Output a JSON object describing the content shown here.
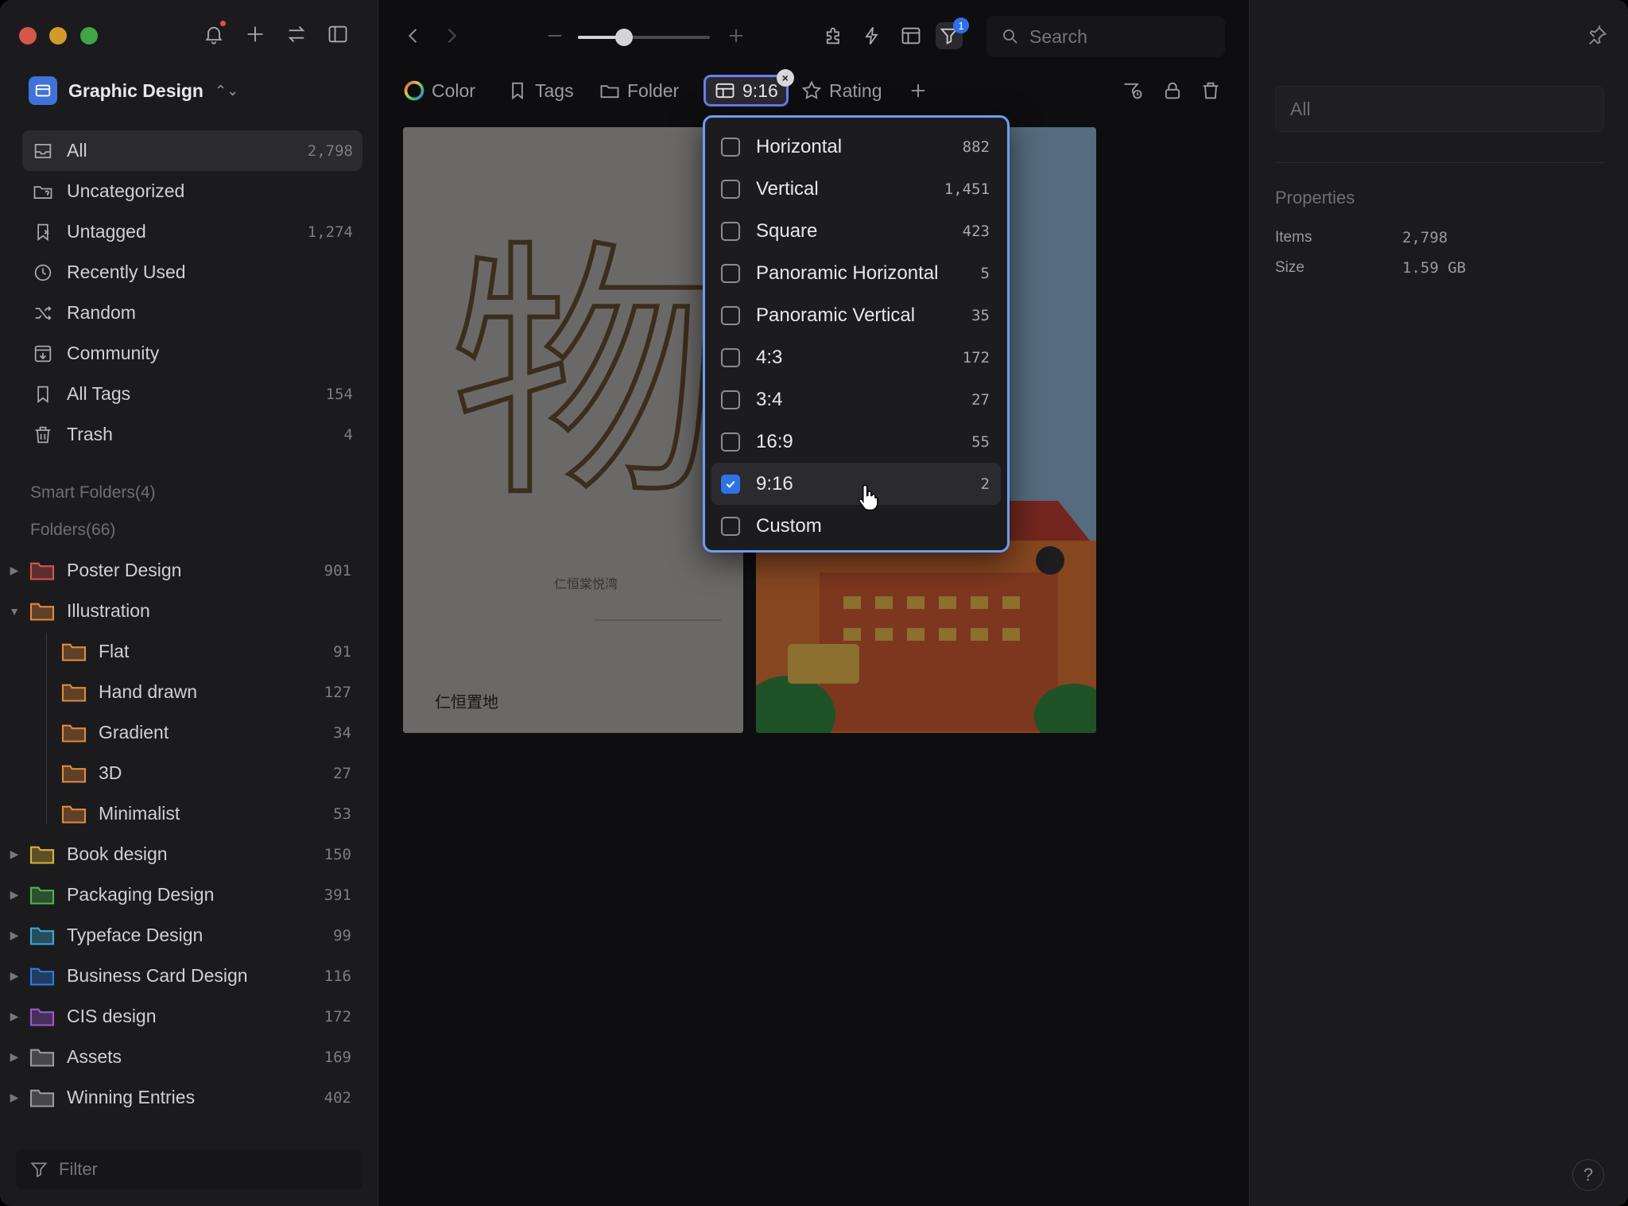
{
  "sidebar": {
    "library_name": "Graphic Design",
    "nav": [
      {
        "label": "All",
        "count": "2,798",
        "icon": "inbox-icon",
        "active": true
      },
      {
        "label": "Uncategorized",
        "count": "",
        "icon": "folder-question-icon"
      },
      {
        "label": "Untagged",
        "count": "1,274",
        "icon": "tag-off-icon"
      },
      {
        "label": "Recently Used",
        "count": "",
        "icon": "clock-icon"
      },
      {
        "label": "Random",
        "count": "",
        "icon": "shuffle-icon"
      },
      {
        "label": "Community",
        "count": "",
        "icon": "download-box-icon"
      },
      {
        "label": "All Tags",
        "count": "154",
        "icon": "bookmark-icon"
      },
      {
        "label": "Trash",
        "count": "4",
        "icon": "trash-icon"
      }
    ],
    "smart_folders_label": "Smart Folders(4)",
    "folders_label": "Folders(66)",
    "folders": [
      {
        "label": "Poster Design",
        "count": "901",
        "color": "#d9534f",
        "expanded": false
      },
      {
        "label": "Illustration",
        "count": "",
        "color": "#e08a3c",
        "expanded": true
      },
      {
        "label": "Flat",
        "count": "91",
        "color": "#e08a3c",
        "sub": true
      },
      {
        "label": "Hand drawn",
        "count": "127",
        "color": "#e08a3c",
        "sub": true
      },
      {
        "label": "Gradient",
        "count": "34",
        "color": "#e08a3c",
        "sub": true
      },
      {
        "label": "3D",
        "count": "27",
        "color": "#e08a3c",
        "sub": true
      },
      {
        "label": "Minimalist",
        "count": "53",
        "color": "#e08a3c",
        "sub": true
      },
      {
        "label": "Book design",
        "count": "150",
        "color": "#d8b23a",
        "expanded": false
      },
      {
        "label": "Packaging Design",
        "count": "391",
        "color": "#4fb34f",
        "expanded": false
      },
      {
        "label": "Typeface Design",
        "count": "99",
        "color": "#3ca8d8",
        "expanded": false
      },
      {
        "label": "Business Card Design",
        "count": "116",
        "color": "#2f7be0",
        "expanded": false
      },
      {
        "label": "CIS design",
        "count": "172",
        "color": "#9b59d0",
        "expanded": false
      },
      {
        "label": "Assets",
        "count": "169",
        "color": "#9a9a9d",
        "expanded": false
      },
      {
        "label": "Winning Entries",
        "count": "402",
        "color": "#9a9a9d",
        "expanded": false
      }
    ],
    "filter_placeholder": "Filter"
  },
  "toolbar": {
    "search_placeholder": "Search",
    "filter_badge": "1",
    "zoom_level": 0.35
  },
  "filterbar": {
    "color_label": "Color",
    "tags_label": "Tags",
    "folder_label": "Folder",
    "ratio_label": "9:16",
    "rating_label": "Rating"
  },
  "dropdown": {
    "items": [
      {
        "label": "Horizontal",
        "count": "882",
        "checked": false
      },
      {
        "label": "Vertical",
        "count": "1,451",
        "checked": false
      },
      {
        "label": "Square",
        "count": "423",
        "checked": false
      },
      {
        "label": "Panoramic Horizontal",
        "count": "5",
        "checked": false
      },
      {
        "label": "Panoramic Vertical",
        "count": "35",
        "checked": false
      },
      {
        "label": "4:3",
        "count": "172",
        "checked": false
      },
      {
        "label": "3:4",
        "count": "27",
        "checked": false
      },
      {
        "label": "16:9",
        "count": "55",
        "checked": false
      },
      {
        "label": "9:16",
        "count": "2",
        "checked": true
      },
      {
        "label": "Custom",
        "count": "",
        "checked": false
      }
    ]
  },
  "thumb1": {
    "big_glyph": "物",
    "caption1": "仁恒棠悦湾",
    "caption2": "仁恒置地"
  },
  "rpanel": {
    "tag_placeholder": "All",
    "properties_title": "Properties",
    "items_key": "Items",
    "items_val": "2,798",
    "size_key": "Size",
    "size_val": "1.59 GB",
    "help": "?"
  }
}
